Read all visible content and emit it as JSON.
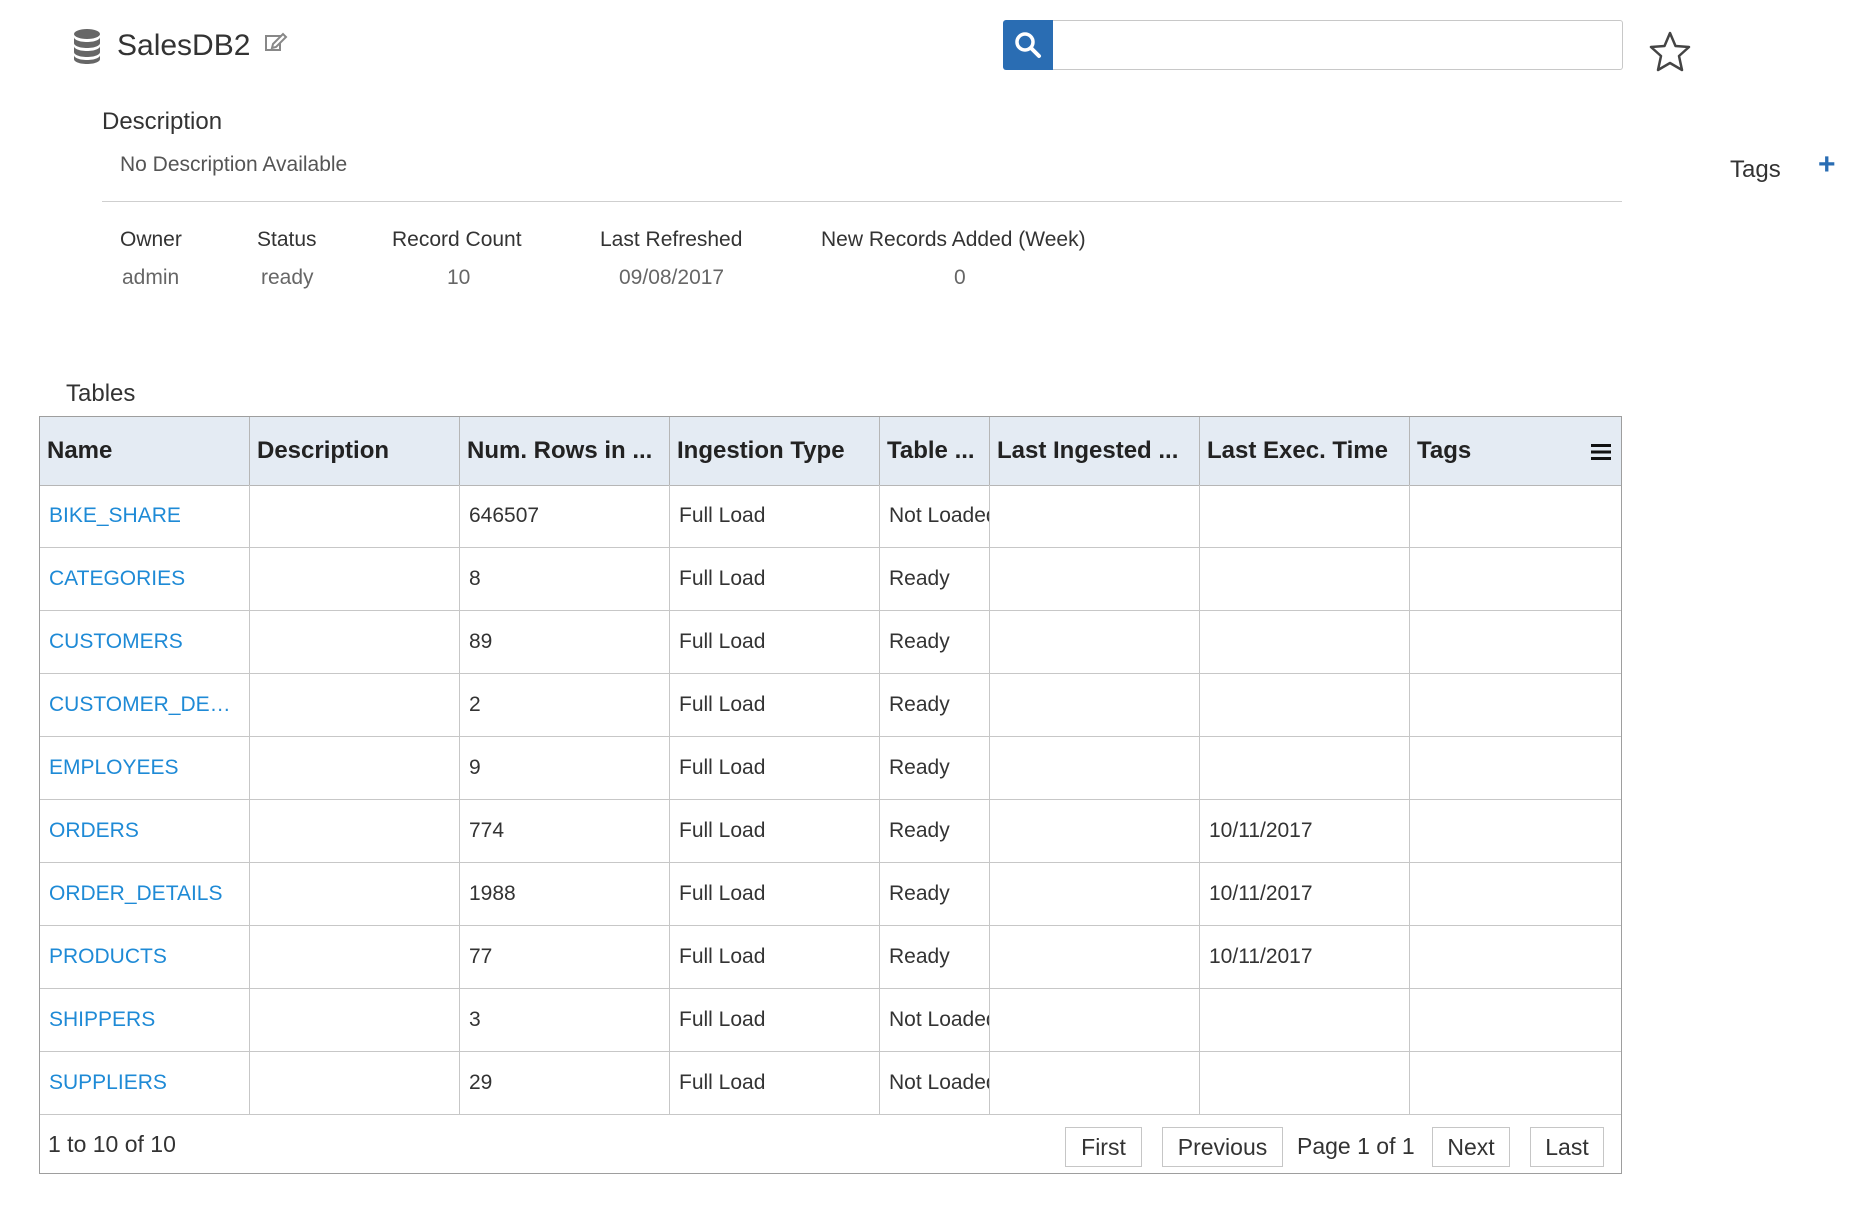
{
  "header": {
    "title": "SalesDB2",
    "search_placeholder": "",
    "tags_label": "Tags",
    "add_tag": "+"
  },
  "description": {
    "title": "Description",
    "text": "No Description Available"
  },
  "meta": [
    {
      "label": "Owner",
      "value": "admin"
    },
    {
      "label": "Status",
      "value": "ready"
    },
    {
      "label": "Record Count",
      "value": "10"
    },
    {
      "label": "Last Refreshed",
      "value": "09/08/2017"
    },
    {
      "label": "New Records Added (Week)",
      "value": "0"
    }
  ],
  "tables": {
    "title": "Tables",
    "columns": [
      "Name",
      "Description",
      "Num. Rows in ...",
      "Ingestion Type",
      "Table ...",
      "Last Ingested ...",
      "Last Exec. Time",
      "Tags"
    ],
    "rows": [
      [
        "BIKE_SHARE",
        "",
        "646507",
        "Full Load",
        "Not Loaded",
        "",
        "",
        ""
      ],
      [
        "CATEGORIES",
        "",
        "8",
        "Full Load",
        "Ready",
        "",
        "",
        ""
      ],
      [
        "CUSTOMERS",
        "",
        "89",
        "Full Load",
        "Ready",
        "",
        "",
        ""
      ],
      [
        "CUSTOMER_DE…",
        "",
        "2",
        "Full Load",
        "Ready",
        "",
        "",
        ""
      ],
      [
        "EMPLOYEES",
        "",
        "9",
        "Full Load",
        "Ready",
        "",
        "",
        ""
      ],
      [
        "ORDERS",
        "",
        "774",
        "Full Load",
        "Ready",
        "",
        "10/11/2017",
        ""
      ],
      [
        "ORDER_DETAILS",
        "",
        "1988",
        "Full Load",
        "Ready",
        "",
        "10/11/2017",
        ""
      ],
      [
        "PRODUCTS",
        "",
        "77",
        "Full Load",
        "Ready",
        "",
        "10/11/2017",
        ""
      ],
      [
        "SHIPPERS",
        "",
        "3",
        "Full Load",
        "Not Loaded",
        "",
        "",
        ""
      ],
      [
        "SUPPLIERS",
        "",
        "29",
        "Full Load",
        "Not Loaded",
        "",
        "",
        ""
      ]
    ],
    "footer": {
      "count_text": "1 to 10 of 10",
      "first": "First",
      "previous": "Previous",
      "page_info": "Page 1 of 1",
      "next": "Next",
      "last": "Last"
    }
  },
  "colors": {
    "accent": "#2a6db3",
    "link": "#1e8ad6",
    "header_bg": "#e4ebf3"
  }
}
